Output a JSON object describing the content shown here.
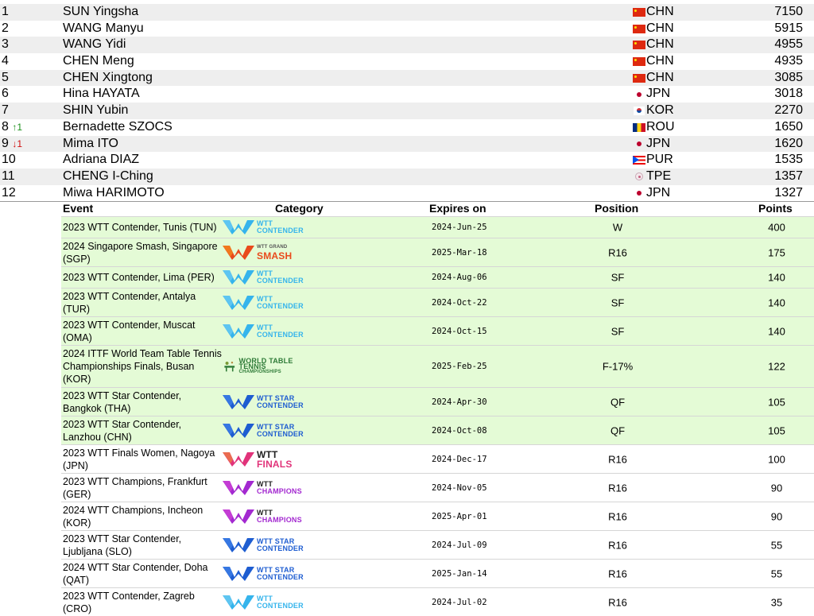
{
  "rankings": [
    {
      "rank": "1",
      "change": "",
      "dir": "",
      "name": "SUN Yingsha",
      "flag": "chn",
      "country": "CHN",
      "points": "7150"
    },
    {
      "rank": "2",
      "change": "",
      "dir": "",
      "name": "WANG Manyu",
      "flag": "chn",
      "country": "CHN",
      "points": "5915"
    },
    {
      "rank": "3",
      "change": "",
      "dir": "",
      "name": "WANG Yidi",
      "flag": "chn",
      "country": "CHN",
      "points": "4955"
    },
    {
      "rank": "4",
      "change": "",
      "dir": "",
      "name": "CHEN Meng",
      "flag": "chn",
      "country": "CHN",
      "points": "4935"
    },
    {
      "rank": "5",
      "change": "",
      "dir": "",
      "name": "CHEN Xingtong",
      "flag": "chn",
      "country": "CHN",
      "points": "3085"
    },
    {
      "rank": "6",
      "change": "",
      "dir": "",
      "name": "Hina HAYATA",
      "flag": "jpn",
      "country": "JPN",
      "points": "3018"
    },
    {
      "rank": "7",
      "change": "",
      "dir": "",
      "name": "SHIN Yubin",
      "flag": "kor",
      "country": "KOR",
      "points": "2270"
    },
    {
      "rank": "8",
      "change": "↑1",
      "dir": "up",
      "name": "Bernadette SZOCS",
      "flag": "rou",
      "country": "ROU",
      "points": "1650"
    },
    {
      "rank": "9",
      "change": "↓1",
      "dir": "down",
      "name": "Mima ITO",
      "flag": "jpn",
      "country": "JPN",
      "points": "1620"
    },
    {
      "rank": "10",
      "change": "",
      "dir": "",
      "name": "Adriana DIAZ",
      "flag": "pur",
      "country": "PUR",
      "points": "1535"
    },
    {
      "rank": "11",
      "change": "",
      "dir": "",
      "name": "CHENG I-Ching",
      "flag": "tpe",
      "country": "TPE",
      "points": "1357"
    },
    {
      "rank": "12",
      "change": "",
      "dir": "",
      "name": "Miwa HARIMOTO",
      "flag": "jpn",
      "country": "JPN",
      "points": "1327"
    }
  ],
  "detail": {
    "headers": {
      "event": "Event",
      "category": "Category",
      "expires": "Expires on",
      "position": "Position",
      "points": "Points"
    },
    "rows": [
      {
        "event": "2023 WTT Contender, Tunis (TUN)",
        "logo": "contender",
        "logo_l1": "WTT",
        "logo_l2": "CONTENDER",
        "expires": "2024-Jun-25",
        "position": "W",
        "points": "400",
        "green": true
      },
      {
        "event": "2024 Singapore Smash, Singapore (SGP)",
        "logo": "smash",
        "logo_l1": "WTT GRAND",
        "logo_l2": "SMASH",
        "expires": "2025-Mar-18",
        "position": "R16",
        "points": "175",
        "green": true
      },
      {
        "event": "2023 WTT Contender, Lima (PER)",
        "logo": "contender",
        "logo_l1": "WTT",
        "logo_l2": "CONTENDER",
        "expires": "2024-Aug-06",
        "position": "SF",
        "points": "140",
        "green": true
      },
      {
        "event": "2023 WTT Contender, Antalya (TUR)",
        "logo": "contender",
        "logo_l1": "WTT",
        "logo_l2": "CONTENDER",
        "expires": "2024-Oct-22",
        "position": "SF",
        "points": "140",
        "green": true
      },
      {
        "event": "2023 WTT Contender, Muscat (OMA)",
        "logo": "contender",
        "logo_l1": "WTT",
        "logo_l2": "CONTENDER",
        "expires": "2024-Oct-15",
        "position": "SF",
        "points": "140",
        "green": true
      },
      {
        "event": "2024 ITTF World Team Table Tennis Championships Finals, Busan (KOR)",
        "logo": "wttc",
        "logo_l1": "WORLD TABLE TENNIS",
        "logo_l2": "CHAMPIONSHIPS",
        "expires": "2025-Feb-25",
        "position": "F-17%",
        "points": "122",
        "green": true
      },
      {
        "event": "2023 WTT Star Contender, Bangkok (THA)",
        "logo": "star",
        "logo_l1": "WTT STAR",
        "logo_l2": "CONTENDER",
        "expires": "2024-Apr-30",
        "position": "QF",
        "points": "105",
        "green": true
      },
      {
        "event": "2023 WTT Star Contender, Lanzhou (CHN)",
        "logo": "star",
        "logo_l1": "WTT STAR",
        "logo_l2": "CONTENDER",
        "expires": "2024-Oct-08",
        "position": "QF",
        "points": "105",
        "green": true
      },
      {
        "event": "2023 WTT Finals Women, Nagoya (JPN)",
        "logo": "finals",
        "logo_l1": "WTT",
        "logo_l2": "FINALS",
        "expires": "2024-Dec-17",
        "position": "R16",
        "points": "100",
        "green": false
      },
      {
        "event": "2023 WTT Champions, Frankfurt (GER)",
        "logo": "champions",
        "logo_l1": "WTT",
        "logo_l2": "CHAMPIONS",
        "expires": "2024-Nov-05",
        "position": "R16",
        "points": "90",
        "green": false
      },
      {
        "event": "2024 WTT Champions, Incheon (KOR)",
        "logo": "champions",
        "logo_l1": "WTT",
        "logo_l2": "CHAMPIONS",
        "expires": "2025-Apr-01",
        "position": "R16",
        "points": "90",
        "green": false
      },
      {
        "event": "2023 WTT Star Contender, Ljubljana (SLO)",
        "logo": "star",
        "logo_l1": "WTT STAR",
        "logo_l2": "CONTENDER",
        "expires": "2024-Jul-09",
        "position": "R16",
        "points": "55",
        "green": false
      },
      {
        "event": "2024 WTT Star Contender, Doha (QAT)",
        "logo": "star",
        "logo_l1": "WTT STAR",
        "logo_l2": "CONTENDER",
        "expires": "2025-Jan-14",
        "position": "R16",
        "points": "55",
        "green": false
      },
      {
        "event": "2023 WTT Contender, Zagreb (CRO)",
        "logo": "contender",
        "logo_l1": "WTT",
        "logo_l2": "CONTENDER",
        "expires": "2024-Jul-02",
        "position": "R16",
        "points": "35",
        "green": false
      }
    ]
  }
}
